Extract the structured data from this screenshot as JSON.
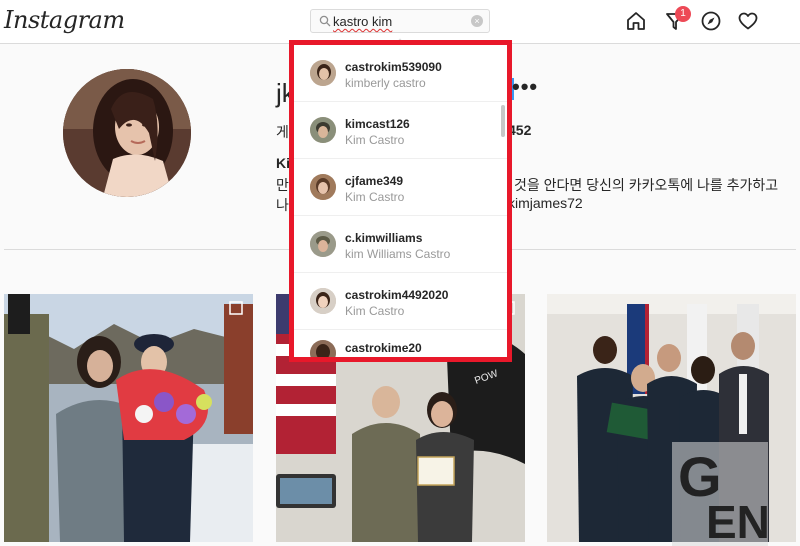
{
  "header": {
    "logo": "Instagram",
    "search": {
      "value": "kastro kim",
      "clear_label": "×"
    },
    "notification_count": "1"
  },
  "profile": {
    "username_partial": "jk",
    "more": "•••",
    "stat_left": "게시",
    "stat_right": "452",
    "bio_name_partial": "Ki",
    "bio_line1_left": "만어",
    "bio_line1_right": "것을 안다면 당신의 카카오톡에 나를 추가하고",
    "bio_line2_left": "나어",
    "bio_line2_right": "kimjames72"
  },
  "search_results": [
    {
      "username": "castrokim539090",
      "fullname": "kimberly castro"
    },
    {
      "username": "kimcast126",
      "fullname": "Kim Castro"
    },
    {
      "username": "cjfame349",
      "fullname": "Kim Castro"
    },
    {
      "username": "c.kimwilliams",
      "fullname": "kim Williams Castro"
    },
    {
      "username": "castrokim4492020",
      "fullname": "Kim Castro"
    },
    {
      "username": "castrokime20",
      "fullname": ""
    }
  ],
  "posts": [
    {
      "name": "post-military-bouquet"
    },
    {
      "name": "post-certificate-flags"
    },
    {
      "name": "post-group-certificate"
    }
  ],
  "watermark": {
    "text": "GEN"
  },
  "colors": {
    "highlight_frame": "#e8182a",
    "badge": "#ed4956",
    "link_blue": "#3897f0"
  }
}
